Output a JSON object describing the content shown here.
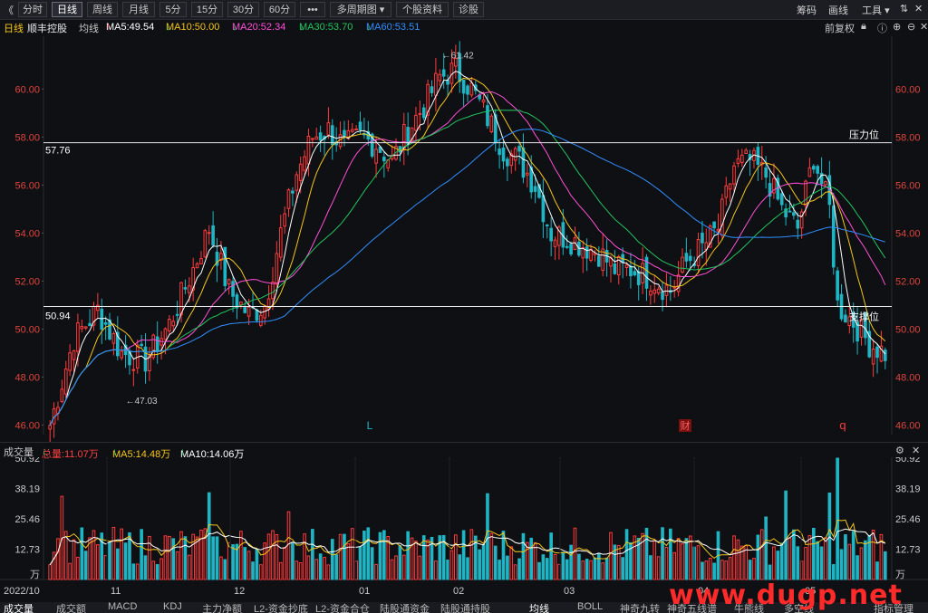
{
  "toolbar": {
    "back_glyph": "《",
    "periods": [
      "分时",
      "日线",
      "周线",
      "月线",
      "5分",
      "15分",
      "30分",
      "60分",
      "•••",
      "多周期图",
      "个股资料",
      "诊股"
    ],
    "active_period": "日线",
    "right_links": [
      "筹码",
      "画线",
      "工具"
    ]
  },
  "info": {
    "period": "日线",
    "stock_name": "顺丰控股",
    "avg_label": "均线",
    "ma5": "MA5:49.54",
    "ma10": "MA10:50.00",
    "ma20": "MA20:52.34",
    "ma30": "MA30:53.70",
    "ma60": "MA60:53.51",
    "adjust": "前复权"
  },
  "colors": {
    "up": "#ff3b3b",
    "down": "#1fb5c4",
    "ma5": "#ffffff",
    "ma10": "#f5c518",
    "ma20": "#ff4fd8",
    "ma30": "#22c55e",
    "ma60": "#2f8fff"
  },
  "chart_data": [
    {
      "type": "candlestick",
      "title": "顺丰控股 日线",
      "ylim": [
        45.6,
        62.2
      ],
      "y_ticks": [
        "60.00",
        "58.00",
        "56.00",
        "54.00",
        "52.00",
        "50.00",
        "48.00",
        "46.00"
      ],
      "x_ticks": [
        "2022/10",
        "11",
        "12",
        "01",
        "02",
        "03",
        "04",
        "05"
      ],
      "annotations": {
        "high_label": "61.42",
        "low_label": "47.03",
        "resistance_label": "压力位",
        "resistance_value": "57.76",
        "support_label": "支撑位",
        "support_value": "50.94",
        "marks": [
          "L",
          "财",
          "q"
        ]
      },
      "ma_lines": [
        "MA5",
        "MA10",
        "MA20",
        "MA30",
        "MA60"
      ]
    },
    {
      "type": "bar",
      "title": "成交量",
      "legend": {
        "total": "总量:11.07万",
        "ma5": "MA5:14.48万",
        "ma10": "MA10:14.06万"
      },
      "ylim": [
        0,
        50.92
      ],
      "y_ticks": [
        "50.92",
        "38.19",
        "25.46",
        "12.73",
        "万"
      ],
      "unit": "万"
    }
  ],
  "bottom_tabs": [
    "成交量",
    "成交额",
    "MACD",
    "KDJ",
    "主力净额",
    "L2-资金抄底",
    "L2-资金合仓",
    "陆股通资金",
    "陆股通持股",
    "均线",
    "BOLL",
    "神奇九转",
    "神奇五线谱",
    "牛熊线",
    "多空线",
    "指标管理"
  ],
  "watermark": "www.dugp.net"
}
